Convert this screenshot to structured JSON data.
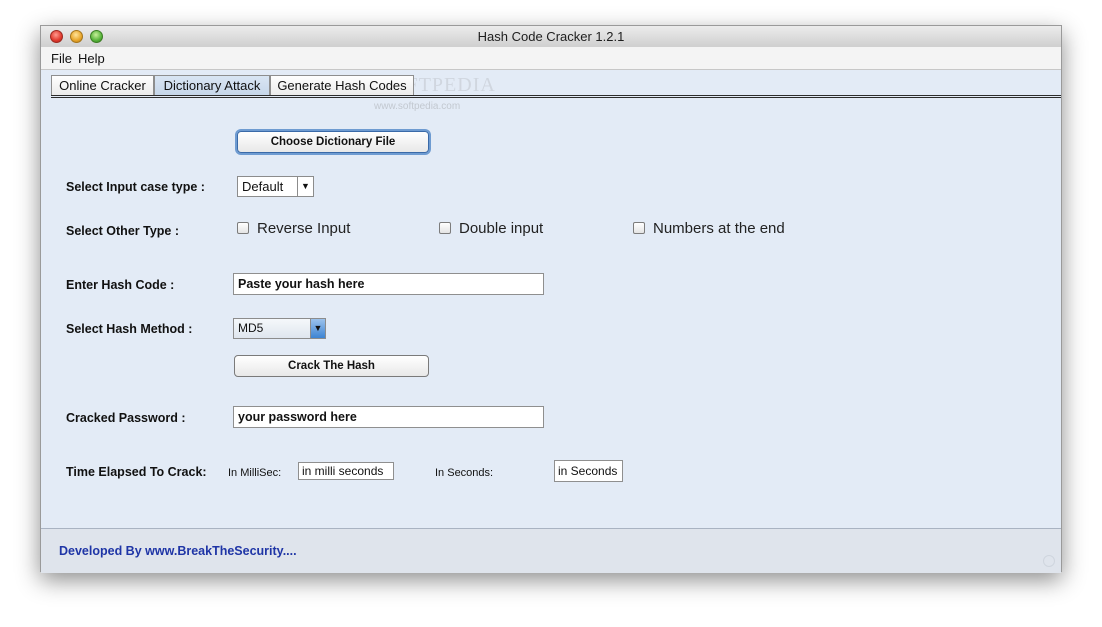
{
  "window": {
    "title": "Hash Code Cracker 1.2.1"
  },
  "menu": {
    "items": [
      "File",
      "Help"
    ]
  },
  "tabs": [
    {
      "label": "Online Cracker"
    },
    {
      "label": "Dictionary Attack",
      "active": true
    },
    {
      "label": "Generate Hash Codes"
    }
  ],
  "watermark": {
    "main": "SOFTPEDIA",
    "sub": "www.softpedia.com"
  },
  "form": {
    "choose_file_label": "Choose Dictionary File",
    "case_type_label": "Select Input case type :",
    "case_type_value": "Default",
    "other_type_label": "Select Other Type :",
    "options": [
      "Reverse Input",
      "Double input",
      "Numbers at the end"
    ],
    "hash_code_label": "Enter Hash Code :",
    "hash_code_value": "Paste your hash here",
    "hash_method_label": "Select Hash Method :",
    "hash_method_value": "MD5",
    "crack_button": "Crack The Hash",
    "cracked_label": "Cracked Password :",
    "cracked_value": "your password here",
    "time_label": "Time Elapsed To Crack:",
    "millis_label": "In MilliSec:",
    "millis_value": "in milli seconds",
    "seconds_label": "In Seconds:",
    "seconds_value": "in Seconds"
  },
  "footer": {
    "text": "Developed By www.BreakTheSecurity...."
  },
  "colors": {
    "background": "#e3ebf6",
    "footer_text": "#1f35a6",
    "focus_ring": "#6e9bd1"
  }
}
